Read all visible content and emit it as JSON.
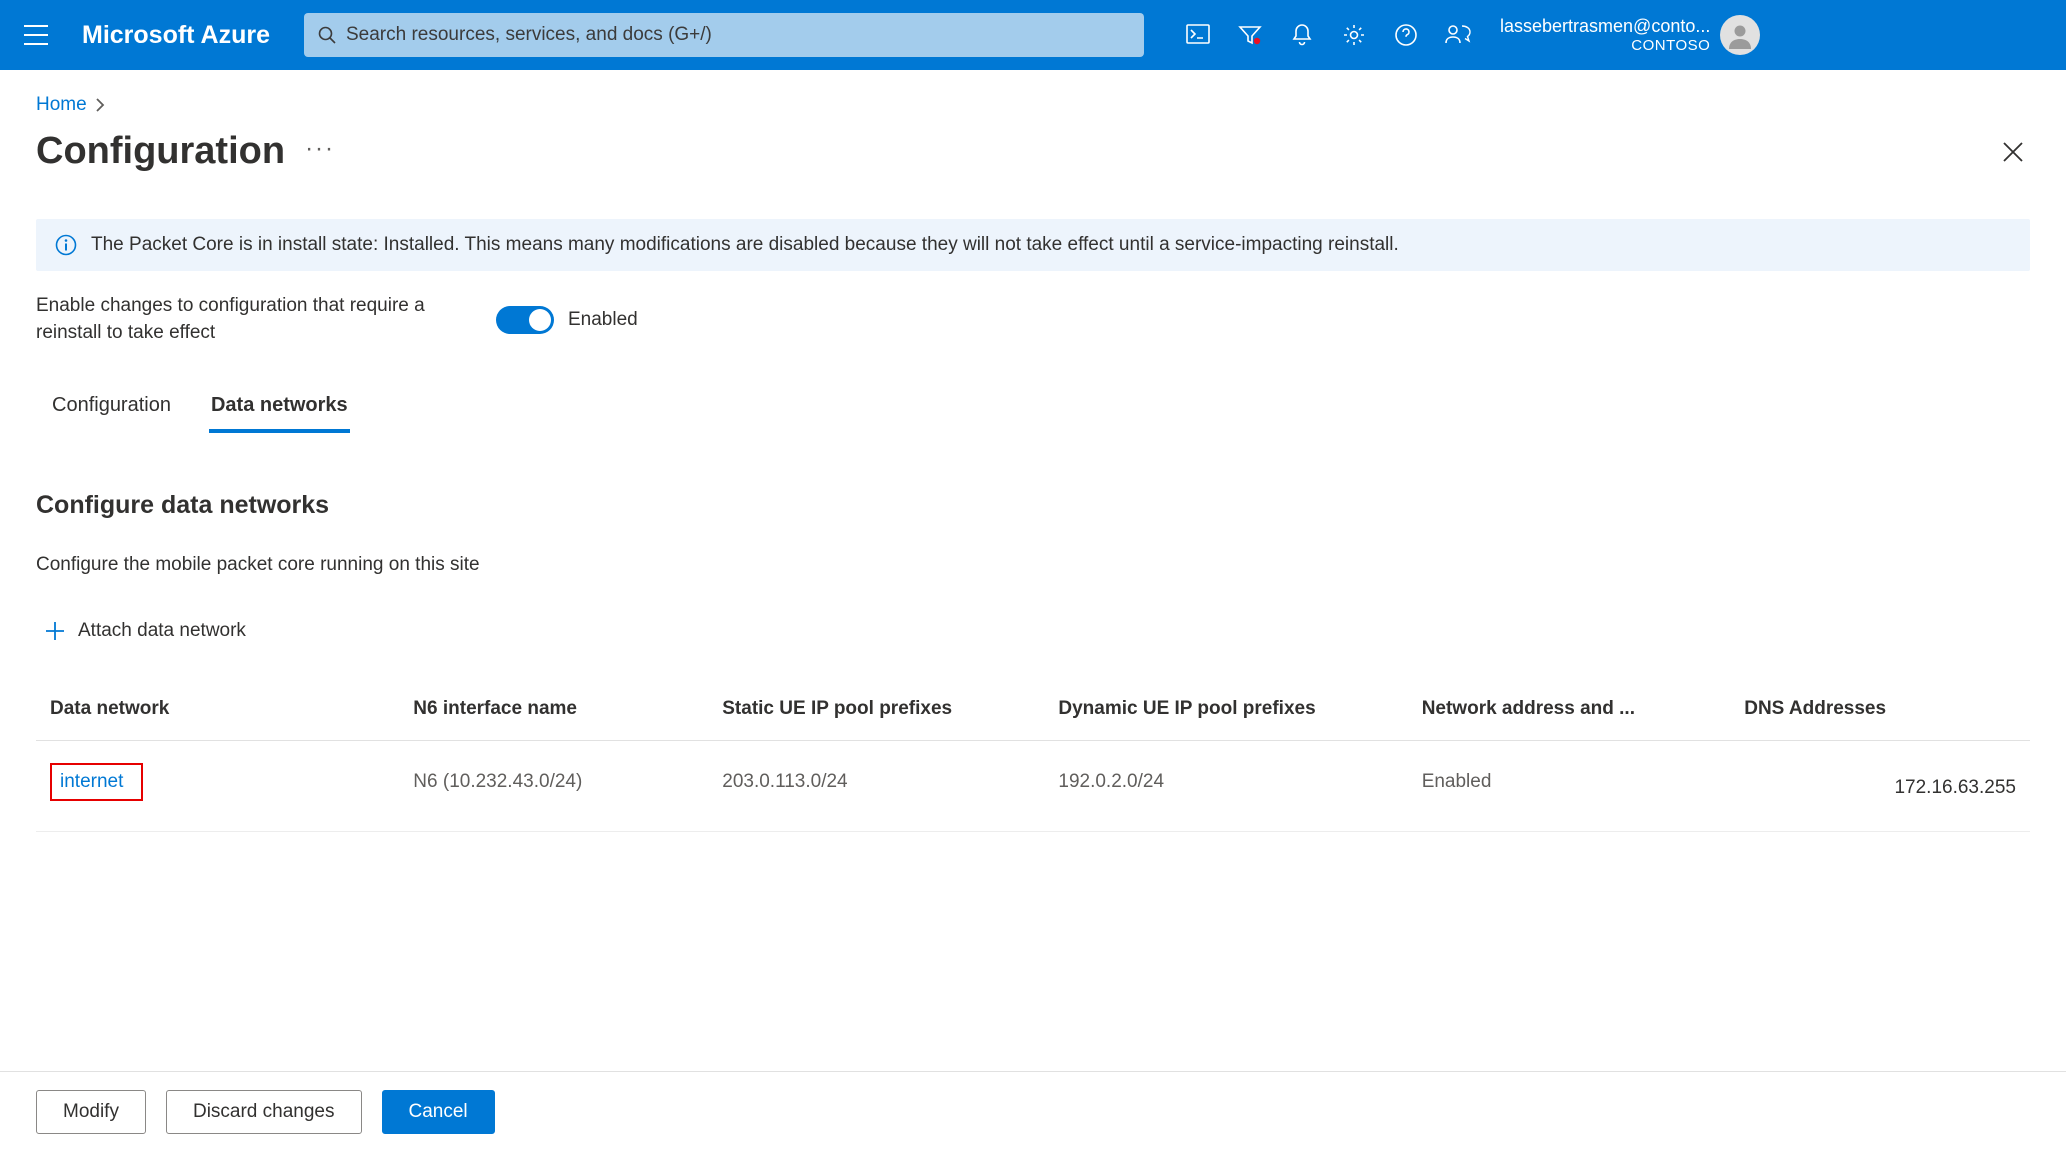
{
  "header": {
    "brand": "Microsoft Azure",
    "search_placeholder": "Search resources, services, and docs (G+/)",
    "account_email": "lassebertrasmen@conto...",
    "account_tenant": "CONTOSO"
  },
  "breadcrumb": {
    "items": [
      "Home"
    ]
  },
  "page": {
    "title": "Configuration",
    "notice": "The Packet Core is in install state: Installed. This means many modifications are disabled because they will not take effect until a service-impacting reinstall.",
    "toggle_label": "Enable changes to configuration that require a reinstall to take effect",
    "toggle_state_text": "Enabled",
    "toggle_on": true
  },
  "tabs": [
    {
      "label": "Configuration",
      "active": false
    },
    {
      "label": "Data networks",
      "active": true
    }
  ],
  "section": {
    "title": "Configure data networks",
    "description": "Configure the mobile packet core running on this site",
    "attach_label": "Attach data network"
  },
  "table": {
    "columns": [
      "Data network",
      "N6 interface name",
      "Static UE IP pool prefixes",
      "Dynamic UE IP pool prefixes",
      "Network address and ...",
      "DNS Addresses"
    ],
    "rows": [
      {
        "name": "internet",
        "n6": "N6 (10.232.43.0/24)",
        "static": "203.0.113.0/24",
        "dynamic": "192.0.2.0/24",
        "nat": "Enabled",
        "dns": "172.16.63.255"
      }
    ]
  },
  "footer": {
    "modify": "Modify",
    "discard": "Discard changes",
    "cancel": "Cancel"
  }
}
